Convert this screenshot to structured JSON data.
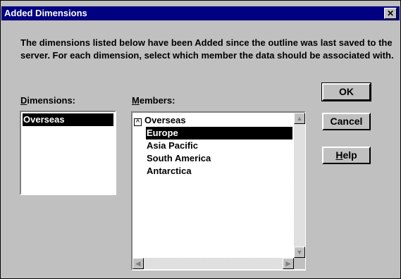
{
  "dialog": {
    "title": "Added Dimensions",
    "close_glyph": "✕",
    "description": "The dimensions listed below have been Added since the outline was last saved to the server.  For each dimension, select which member the data should be associated with."
  },
  "dimensions": {
    "label_key": "D",
    "label_rest": "imensions:",
    "items": [
      "Overseas"
    ],
    "selected_index": 0
  },
  "members": {
    "label_key": "M",
    "label_rest": "embers:",
    "root": "Overseas",
    "expander_glyph": "^",
    "items": [
      "Europe",
      "Asia Pacific",
      "South America",
      "Antarctica"
    ],
    "selected_index": 0
  },
  "buttons": {
    "ok": "OK",
    "cancel": "Cancel",
    "help_key": "H",
    "help_rest": "elp"
  },
  "icons": {
    "scroll_up": "▲",
    "scroll_down": "▼",
    "scroll_left": "◀",
    "scroll_right": "▶"
  }
}
